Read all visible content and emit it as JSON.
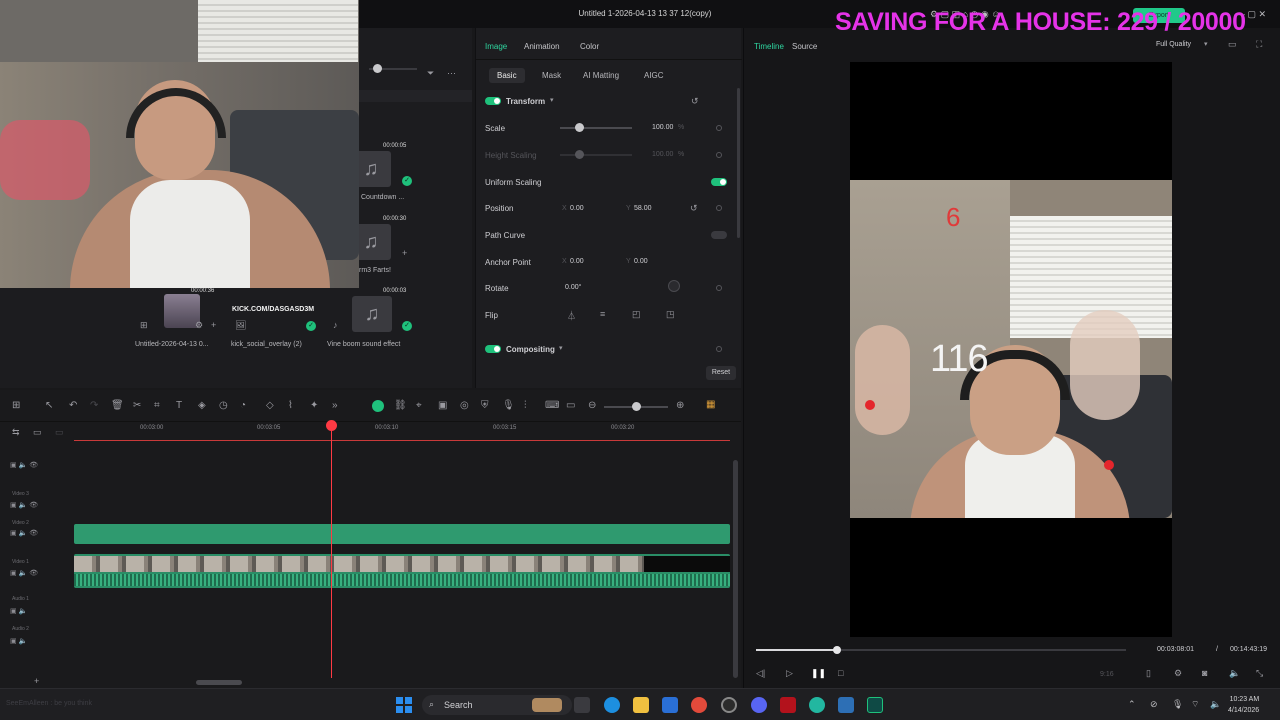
{
  "window": {
    "title": "Untitled 1-2026-04-13 13 37 12(copy)",
    "export_label": "Export"
  },
  "stream_overlay": {
    "goal_text": "SAVING FOR A HOUSE: 229 / 20000",
    "goal_color": "#e533e8",
    "chat_line": "SeeEmAlleen : be you think"
  },
  "media": {
    "items": [
      {
        "duration": "00:00:05",
        "label": "Countdown ...",
        "icon": "music-icon",
        "checked": true
      },
      {
        "duration": "00:00:30",
        "label": "rm3 Farts!",
        "icon": "music-icon",
        "checked": false
      },
      {
        "duration": "00:00:36",
        "label": "Untitled-2026-04-13 0...",
        "icon": "video-thumb",
        "checked": false
      },
      {
        "duration": "",
        "label": "kick_social_overlay (2)",
        "icon": "image-icon",
        "checked": true,
        "thumb_text": "KICK.COM/DASGASD3M"
      },
      {
        "duration": "00:00:03",
        "label": "Vine boom sound effect",
        "icon": "music-icon",
        "checked": true
      }
    ]
  },
  "props": {
    "tabs": [
      "Image",
      "Animation",
      "Color"
    ],
    "active_tab": "Image",
    "subtabs": [
      "Basic",
      "Mask",
      "AI Matting",
      "AIGC"
    ],
    "active_subtab": "Basic",
    "transform_label": "Transform",
    "scale": {
      "label": "Scale",
      "value": "100.00",
      "unit": "%",
      "level": 0.27
    },
    "height_scaling": {
      "label": "Height Scaling",
      "value": "100.00",
      "unit": "%",
      "level": 0.27
    },
    "uniform_scaling": {
      "label": "Uniform Scaling",
      "on": true
    },
    "position": {
      "label": "Position",
      "x_axis": "X",
      "x": "0.00",
      "y_axis": "Y",
      "y": "58.00"
    },
    "path_curve": {
      "label": "Path Curve",
      "on": false
    },
    "anchor": {
      "label": "Anchor Point",
      "x_axis": "X",
      "x": "0.00",
      "y_axis": "Y",
      "y": "0.00"
    },
    "rotate": {
      "label": "Rotate",
      "value": "0.00°"
    },
    "flip": {
      "label": "Flip"
    },
    "compositing_label": "Compositing",
    "reset_label": "Reset"
  },
  "preview": {
    "tabs": [
      "Timeline",
      "Source"
    ],
    "active_tab": "Timeline",
    "quality": "Full Quality",
    "overlay_top": "6",
    "overlay_mid": "116",
    "current_time": "00:03:08:01",
    "separator": "/",
    "total_time": "00:14:43:19",
    "ratio": "9:16",
    "progress": 0.22
  },
  "timeline": {
    "ticks": [
      "00:03:00",
      "00:03:05",
      "00:03:10",
      "00:03:15",
      "00:03:20"
    ],
    "tracks": [
      "Video 3",
      "Video 2",
      "Video 1",
      "Audio 1",
      "Audio 2"
    ]
  },
  "taskbar": {
    "search_placeholder": "Search",
    "time": "10:23 AM",
    "date": "4/14/2026"
  }
}
